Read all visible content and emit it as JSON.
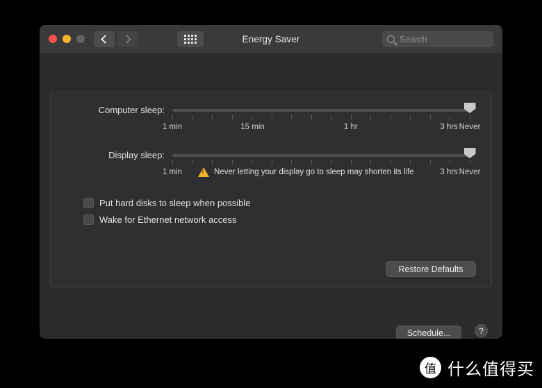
{
  "window": {
    "title": "Energy Saver",
    "traffic_lights": [
      {
        "name": "close",
        "color": "#f9544b"
      },
      {
        "name": "minimize",
        "color": "#f5b32b"
      },
      {
        "name": "zoom",
        "color": "#636366"
      }
    ],
    "nav": {
      "back_icon": "chevron-left-icon",
      "forward_icon": "chevron-right-icon",
      "show_all_icon": "grid-icon"
    },
    "search": {
      "placeholder": "Search",
      "value": "",
      "icon": "search-icon"
    }
  },
  "sliders": [
    {
      "id": "computer-sleep",
      "label": "Computer sleep:",
      "value": "Never",
      "value_percent": 100,
      "ticks": 16,
      "scale": [
        {
          "label": "1 min",
          "percent": 0
        },
        {
          "label": "15 min",
          "percent": 27
        },
        {
          "label": "1 hr",
          "percent": 60
        },
        {
          "label": "3 hrs",
          "percent": 93
        },
        {
          "label": "Never",
          "percent": 100
        }
      ]
    },
    {
      "id": "display-sleep",
      "label": "Display sleep:",
      "value": "Never",
      "value_percent": 100,
      "ticks": 16,
      "scale": [
        {
          "label": "1 min",
          "percent": 0
        },
        {
          "label": "3 hrs",
          "percent": 93
        },
        {
          "label": "Never",
          "percent": 100
        }
      ],
      "warning": {
        "icon": "warning-triangle-icon",
        "text": "Never letting your display go to sleep may shorten its life",
        "color": "#f0b429"
      }
    }
  ],
  "checkboxes": [
    {
      "id": "put-hard-disks-to-sleep",
      "label": "Put hard disks to sleep when possible",
      "checked": false
    },
    {
      "id": "wake-for-ethernet",
      "label": "Wake for Ethernet network access",
      "checked": false
    }
  ],
  "buttons": {
    "restore_defaults": "Restore Defaults",
    "schedule": "Schedule...",
    "help": "?"
  },
  "watermark": {
    "badge": "值",
    "text": "什么值得买"
  },
  "colors": {
    "window_bg": "#2c2c2e",
    "titlebar_bg": "#3a3a3c",
    "panel_bg": "#2f2f31",
    "accent_warning": "#f0b429",
    "text_primary": "#e4e4e6",
    "text_secondary": "#8e8e93"
  }
}
